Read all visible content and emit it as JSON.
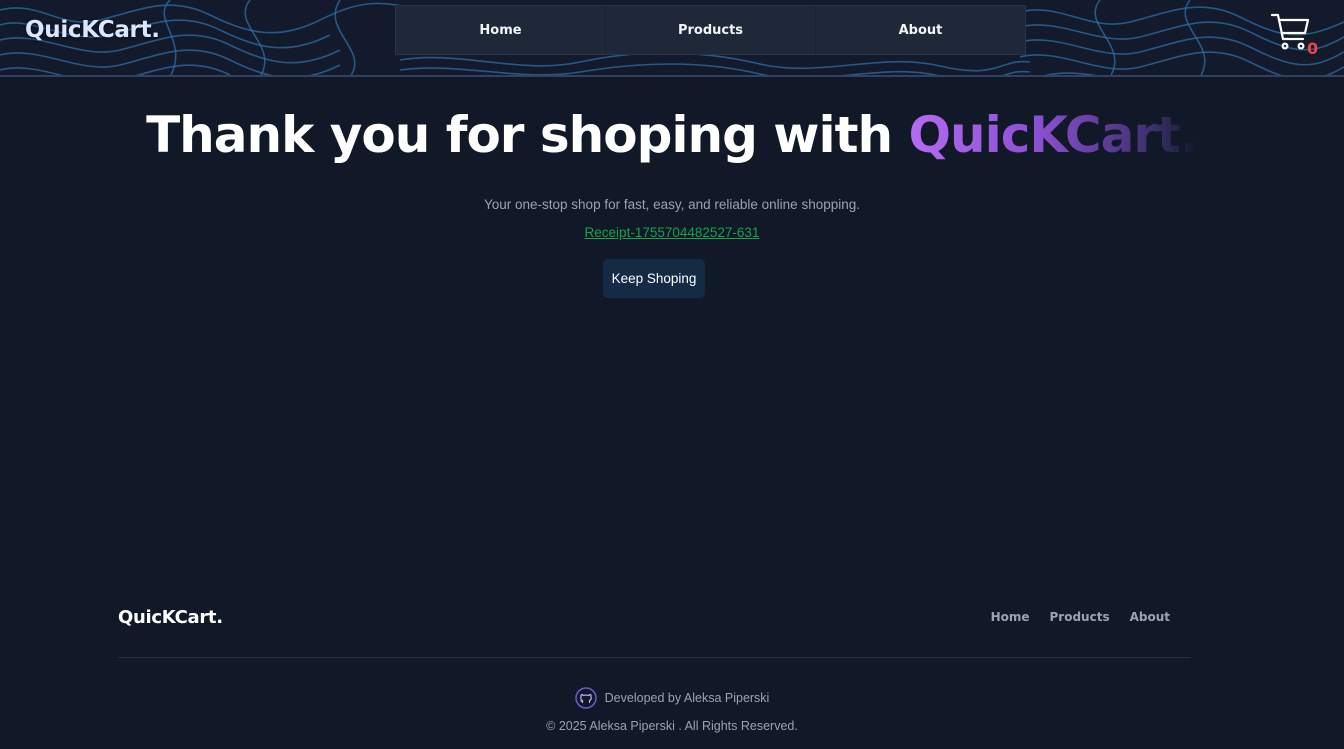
{
  "header": {
    "brand": "QuicKCart.",
    "nav": [
      {
        "label": "Home"
      },
      {
        "label": "Products"
      },
      {
        "label": "About"
      }
    ],
    "cart": {
      "icon": "cart-icon",
      "count": "0"
    }
  },
  "main": {
    "title_prefix": "Thank you for shoping with ",
    "title_brand": "QuicKCart.",
    "subtitle": "Your one-stop shop for fast, easy, and reliable online shopping.",
    "receipt_link": "Receipt-1755704482527-631",
    "keep_button": "Keep Shoping"
  },
  "footer": {
    "brand": "QuicKCart.",
    "nav": [
      {
        "label": "Home"
      },
      {
        "label": "Products"
      },
      {
        "label": "About"
      }
    ],
    "developer": {
      "icon": "github-icon",
      "text": "Developed by Aleksa Piperski"
    },
    "copyright": "© 2025 Aleksa Piperski . All Rights Reserved."
  },
  "colors": {
    "background": "#111827",
    "accent_purple": "#b46cf2",
    "receipt_green": "#16a34a",
    "cart_count_red": "#ef4444",
    "button_bg": "#142a45"
  }
}
